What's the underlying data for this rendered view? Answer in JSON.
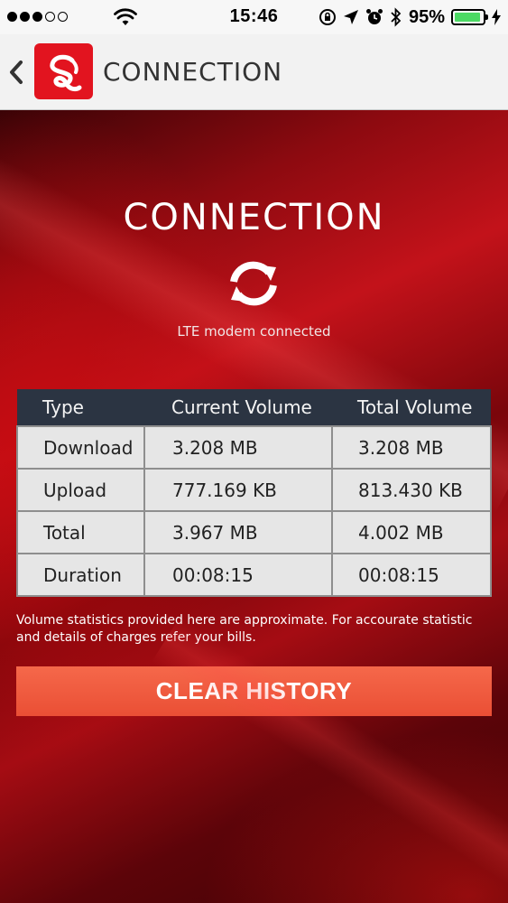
{
  "status_bar": {
    "time": "15:46",
    "battery_percent": "95%",
    "signal_bars": 3,
    "signal_total": 5,
    "battery_level": 0.95
  },
  "nav": {
    "title": "CONNECTION",
    "back_icon": "chevron-left-icon",
    "logo_icon": "app-logo-icon"
  },
  "main": {
    "heading": "CONNECTION",
    "sync_icon": "sync-icon",
    "status": "LTE modem connected"
  },
  "table": {
    "headers": [
      "Type",
      "Current Volume",
      "Total Volume"
    ],
    "rows": [
      [
        "Download",
        "3.208 MB",
        "3.208 MB"
      ],
      [
        "Upload",
        "777.169 KB",
        "813.430 KB"
      ],
      [
        "Total",
        "3.967 MB",
        "4.002 MB"
      ],
      [
        "Duration",
        "00:08:15",
        "00:08:15"
      ]
    ]
  },
  "disclaimer": "Volume statistics provided here are approximate. For accourate statistic and details of charges refer your bills.",
  "clear_button": "CLEAR HISTORY",
  "colors": {
    "brand_red": "#e2141f",
    "button_orange": "#ea4f35",
    "table_header": "#2b3442"
  }
}
